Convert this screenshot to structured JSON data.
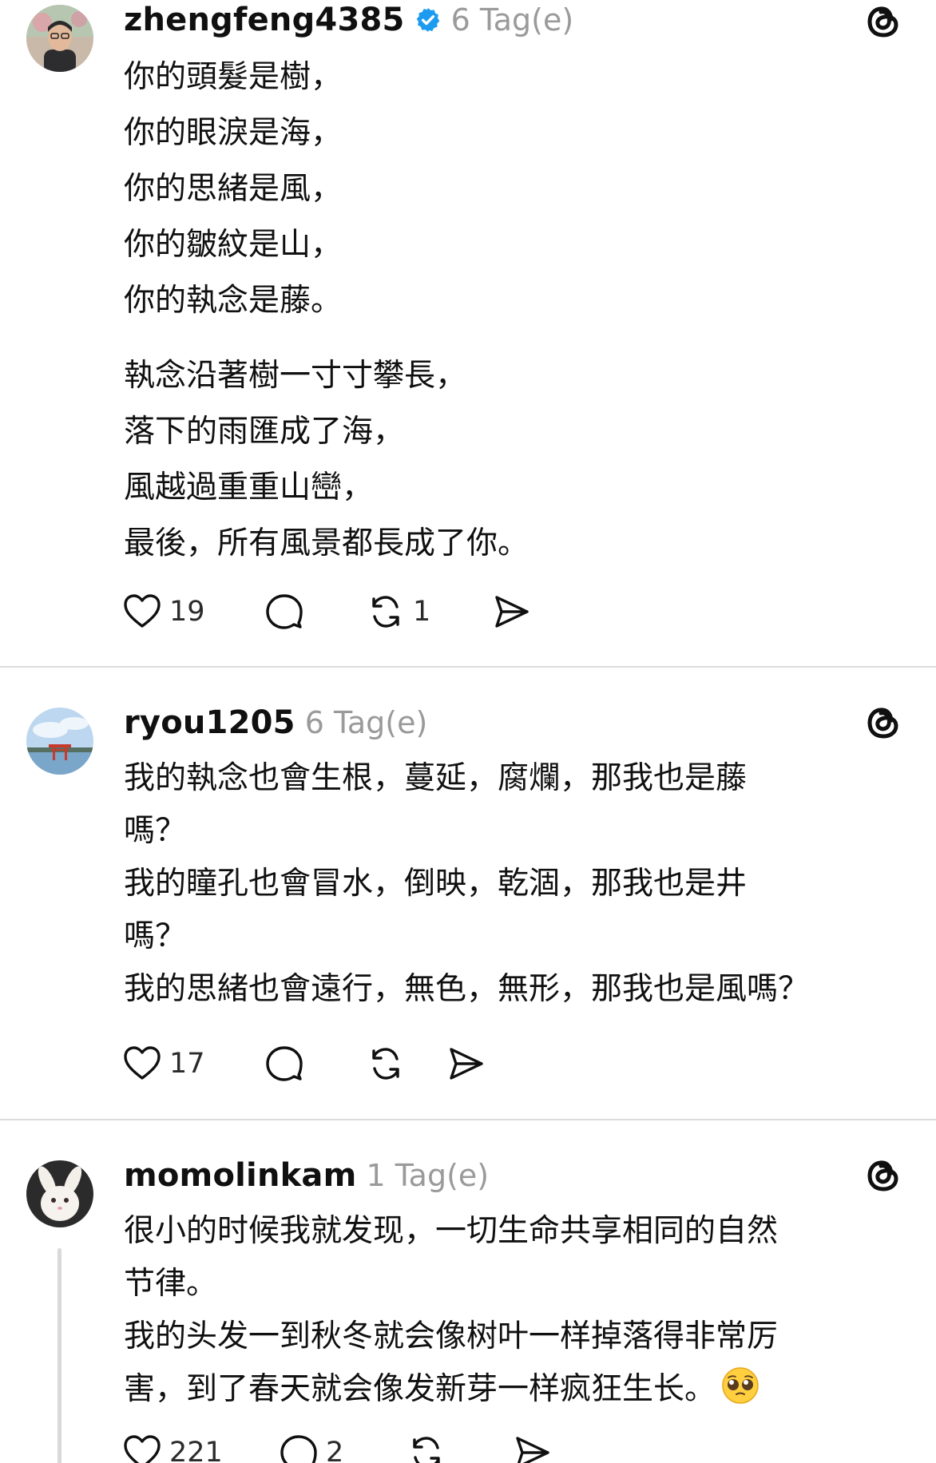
{
  "posts": [
    {
      "username": "zhengfeng4385",
      "verified": true,
      "time": "6 Tag(e)",
      "paragraphs": [
        [
          "你的頭髮是樹，",
          "你的眼淚是海，",
          "你的思緒是風，",
          "你的皺紋是山，",
          "你的執念是藤。"
        ],
        [
          "執念沿著樹一寸寸攀長，",
          "落下的雨匯成了海，",
          "風越過重重山巒，",
          "最後，所有風景都長成了你。"
        ]
      ],
      "likes": "19",
      "comments": "",
      "reposts": "1"
    },
    {
      "username": "ryou1205",
      "verified": false,
      "time": "6 Tag(e)",
      "lines": [
        "我的執念也會生根，蔓延，腐爛，那我也是藤",
        "嗎？",
        "我的瞳孔也會冒水，倒映，乾涸，那我也是井",
        "嗎？",
        "我的思緒也會遠行，無色，無形，那我也是風嗎？"
      ],
      "likes": "17",
      "comments": "",
      "reposts": ""
    },
    {
      "username": "momolinkam",
      "verified": false,
      "time": "1 Tag(e)",
      "lines": [
        "很小的时候我就发现，一切生命共享相同的自然",
        "节律。",
        "我的头发一到秋冬就会像树叶一样掉落得非常厉",
        "害，到了春天就会像发新芽一样疯狂生长。"
      ],
      "emoji": "pleading-face-emoji",
      "likes": "221",
      "comments": "2",
      "reposts": ""
    }
  ],
  "colors": {
    "verified_blue": "#1d9bf0",
    "text": "#101010",
    "muted": "#9a9a9a",
    "divider": "#dcdcdc"
  },
  "icons": [
    "threads-icon",
    "heart-icon",
    "comment-icon",
    "repost-icon",
    "share-icon",
    "verified-badge-icon"
  ]
}
